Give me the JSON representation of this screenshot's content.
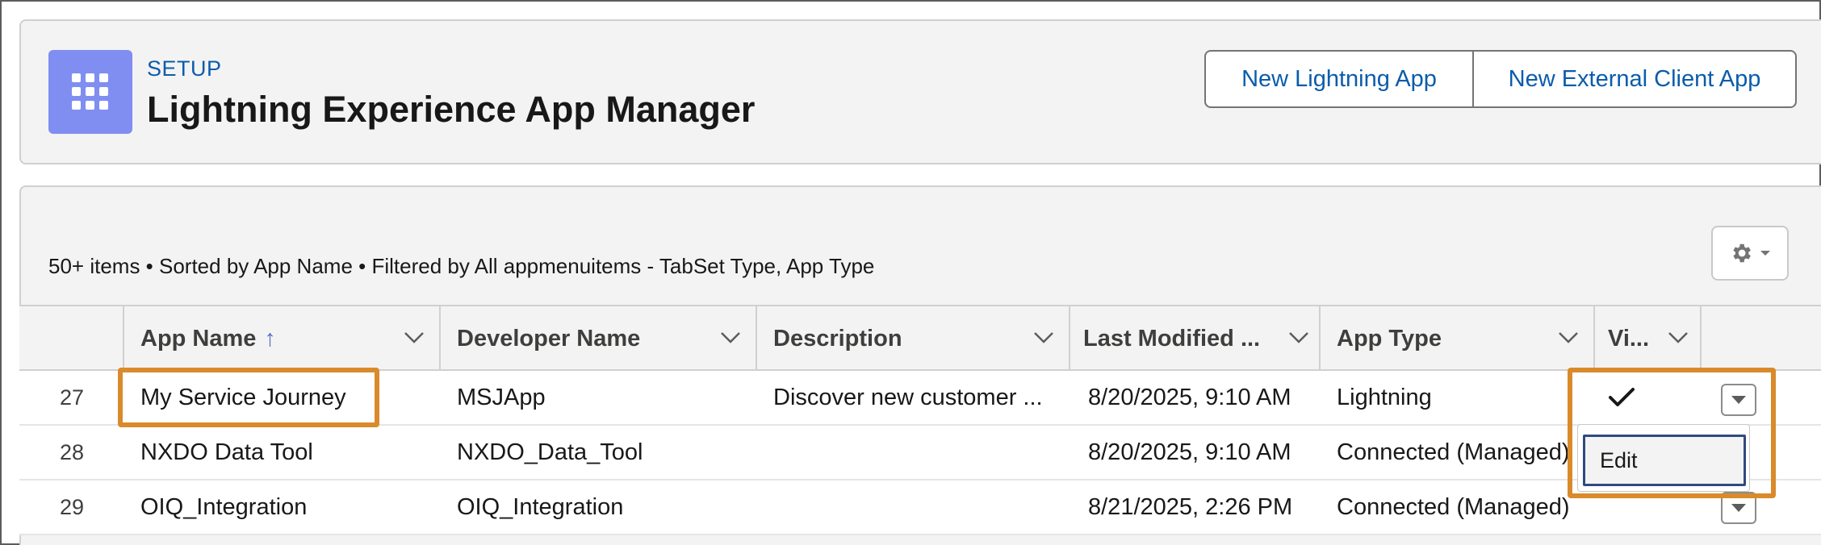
{
  "header": {
    "setup_label": "SETUP",
    "title": "Lightning Experience App Manager",
    "buttons": {
      "new_lightning_app": "New Lightning App",
      "new_external_client_app": "New External Client App"
    }
  },
  "list": {
    "status": "50+ items • Sorted by App Name • Filtered by All appmenuitems - TabSet Type, App Type"
  },
  "columns": {
    "app_name": "App Name",
    "sort_indicator": "↑",
    "developer_name": "Developer Name",
    "description": "Description",
    "last_modified": "Last Modified ...",
    "app_type": "App Type",
    "visible": "Vi..."
  },
  "rows": [
    {
      "num": "27",
      "app_name": "My Service Journey",
      "developer_name": "MSJApp",
      "description": "Discover new customer ...",
      "last_modified": "8/20/2025, 9:10 AM",
      "app_type": "Lightning",
      "visible": "✓"
    },
    {
      "num": "28",
      "app_name": "NXDO Data Tool",
      "developer_name": "NXDO_Data_Tool",
      "description": "",
      "last_modified": "8/20/2025, 9:10 AM",
      "app_type": "Connected (Managed)",
      "visible": ""
    },
    {
      "num": "29",
      "app_name": "OIQ_Integration",
      "developer_name": "OIQ_Integration",
      "description": "",
      "last_modified": "8/21/2025, 2:26 PM",
      "app_type": "Connected (Managed)",
      "visible": ""
    }
  ],
  "row_menu": {
    "edit": "Edit"
  },
  "icons": {
    "app": "app-launcher-grid-icon",
    "gear": "gear-icon",
    "chevron": "chevron-down-icon",
    "check": "check-icon"
  },
  "colors": {
    "brand_blue": "#0b5cab",
    "app_icon_bg": "#7f8ef0",
    "highlight": "#d98b2b"
  }
}
